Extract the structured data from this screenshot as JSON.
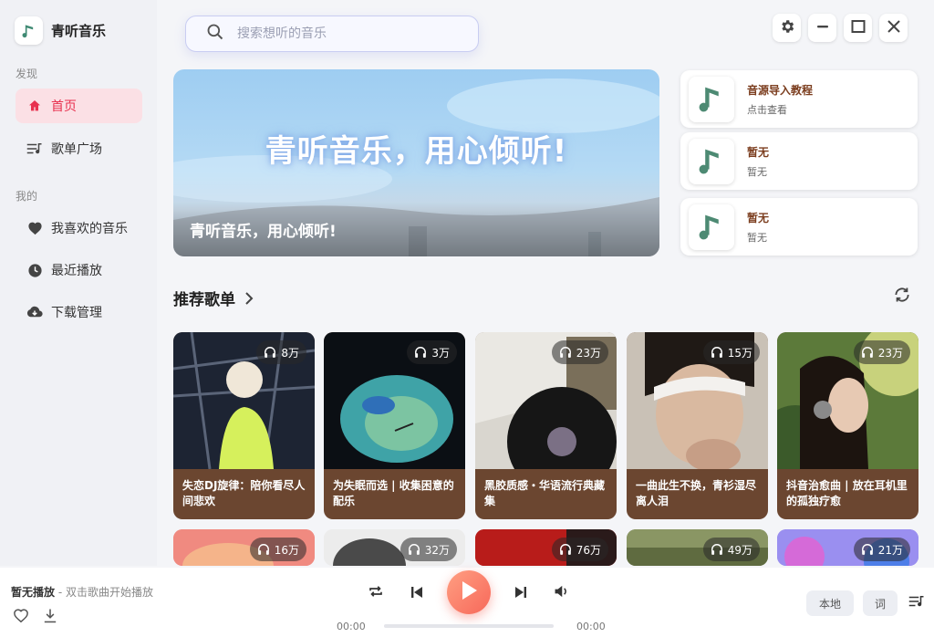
{
  "app": {
    "name": "青听音乐"
  },
  "sidebar": {
    "discover_title": "发现",
    "mine_title": "我的",
    "items": [
      {
        "label": "首页",
        "icon": "home-icon",
        "active": true
      },
      {
        "label": "歌单广场",
        "icon": "playlist-icon",
        "active": false
      },
      {
        "label": "我喜欢的音乐",
        "icon": "heart-icon",
        "active": false
      },
      {
        "label": "最近播放",
        "icon": "clock-icon",
        "active": false
      },
      {
        "label": "下载管理",
        "icon": "cloud-download-icon",
        "active": false
      }
    ]
  },
  "search": {
    "placeholder": "搜索想听的音乐",
    "value": ""
  },
  "banner": {
    "headline": "青听音乐，用心倾听!",
    "caption": "青听音乐，用心倾听!"
  },
  "side_cards": [
    {
      "title": "音源导入教程",
      "subtitle": "点击查看"
    },
    {
      "title": "暂无",
      "subtitle": "暂无"
    },
    {
      "title": "暂无",
      "subtitle": "暂无"
    }
  ],
  "recommend": {
    "title": "推荐歌单",
    "playlists": [
      {
        "name": "失恋DJ旋律：陪你看尽人间悲欢",
        "plays": "8万"
      },
      {
        "name": "为失眠而选 | 收集困意的配乐",
        "plays": "3万"
      },
      {
        "name": "黑胶质感・华语流行典藏集",
        "plays": "23万"
      },
      {
        "name": "一曲此生不换，青衫湿尽离人泪",
        "plays": "15万"
      },
      {
        "name": "抖音治愈曲 | 放在耳机里的孤独疗愈",
        "plays": "23万"
      }
    ],
    "playlists_row2": [
      {
        "plays": "16万"
      },
      {
        "plays": "32万"
      },
      {
        "plays": "76万"
      },
      {
        "plays": "49万"
      },
      {
        "plays": "21万"
      }
    ]
  },
  "player": {
    "status": "暂无播放",
    "hint": " - 双击歌曲开始播放",
    "current_time": "00:00",
    "total_time": "00:00",
    "progress": 0,
    "local_label": "本地",
    "lyrics_label": "词"
  },
  "colors": {
    "accent": "#e8314f",
    "card_bg": "#6b4630",
    "play_gradient_start": "#ff9f82",
    "play_gradient_end": "#f7685a"
  }
}
